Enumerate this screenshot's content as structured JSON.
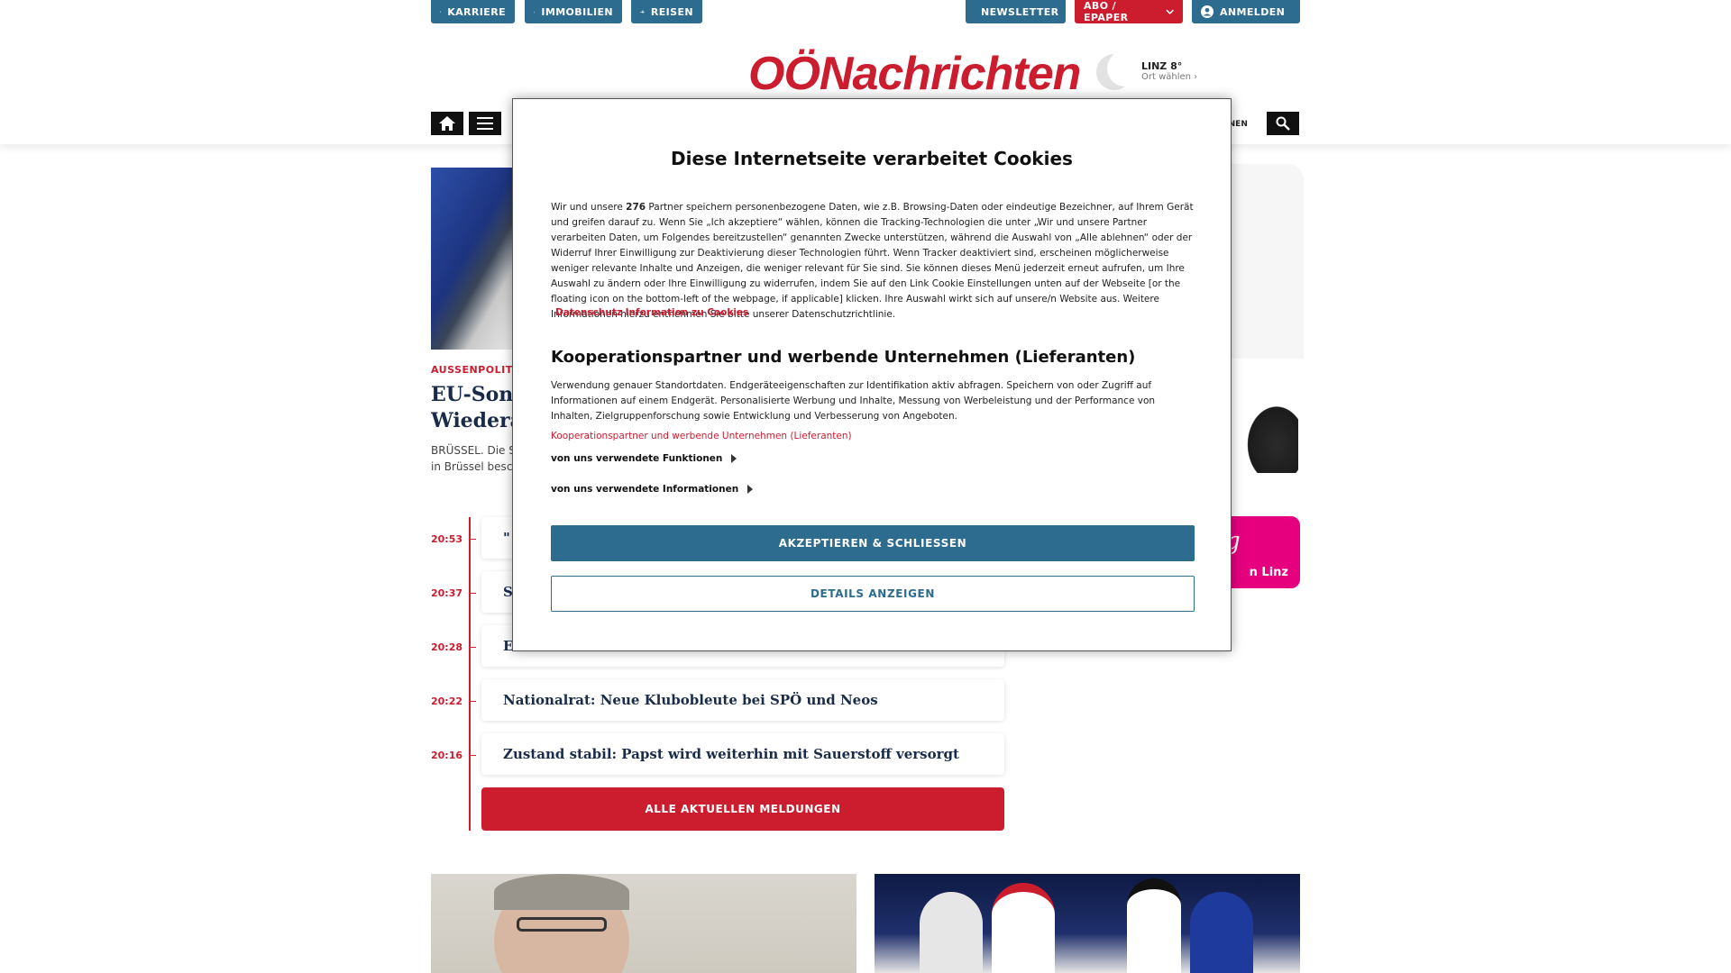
{
  "topbar": {
    "karriere": "KARRIERE",
    "immobilien": "IMMOBILIEN",
    "reisen": "REISEN",
    "newsletter": "NEWSLETTER",
    "abo": "ABO / EPAPER",
    "anmelden": "ANMELDEN"
  },
  "logo": {
    "prefix": "OÖ",
    "name": "Nachrichten"
  },
  "weather": {
    "city": "LINZ 8°",
    "select": "Ort wählen"
  },
  "nav": {
    "partial_item": "ONEN"
  },
  "colors": {
    "brand_red": "#cc1d2f",
    "brand_blue": "#2e6c8f",
    "pink_ad": "#e6007e"
  },
  "hero": {
    "kicker": "AUSSENPOLITIK",
    "headline_line1": "EU-Son",
    "headline_line2": "Wiedera",
    "teaser_line1": "BRÜSSEL. Die S",
    "teaser_line2": "in Brüssel besc"
  },
  "ad": {
    "pink_line1": "g",
    "pink_line2": "n Linz"
  },
  "timeline": {
    "items": [
      {
        "time": "20:53",
        "title": "\""
      },
      {
        "time": "20:37",
        "title": "S"
      },
      {
        "time": "20:28",
        "title": "E"
      },
      {
        "time": "20:22",
        "title": "Nationalrat: Neue Klubobleute bei SPÖ und Neos"
      },
      {
        "time": "20:16",
        "title": "Zustand stabil: Papst wird weiterhin mit Sauerstoff versorgt"
      }
    ],
    "all_button": "ALLE AKTUELLEN MELDUNGEN"
  },
  "cookie_modal": {
    "title": "Diese Internetseite verarbeitet Cookies",
    "body_before_count": "Wir und unsere ",
    "partner_count": "276",
    "body_after_count": " Partner speichern personenbezogene Daten, wie z.B. Browsing-Daten oder eindeutige Bezeichner, auf Ihrem Gerät und greifen darauf zu. Wenn Sie „Ich akzeptiere“ wählen, können die Tracking-Technologien die unter „Wir und unsere Partner verarbeiten Daten, um Folgendes bereitzustellen“ genannten Zwecke unterstützen, während die Auswahl von „Alle ablehnen“ oder der Widerruf Ihrer Einwilligung zur Deaktivierung dieser Technologien führt. Wenn Tracker deaktiviert sind, erscheinen möglicherweise weniger relevante Inhalte und Anzeigen, die weniger relevant für Sie sind. Sie können dieses Menü jederzeit erneut aufrufen, um Ihre Auswahl zu ändern oder Ihre Einwilligung zu widerrufen, indem Sie auf den Link Cookie Einstellungen unten auf der Webseite [or the floating icon on the bottom-left of the webpage, if applicable] klicken. Ihre Auswahl wirkt sich auf unsere/n Website aus. Weitere Informationen hierzu entnehmen Sie bitte unserer Datenschutzrichtlinie.",
    "privacy_link": "Datenschutz Information zu Cookies",
    "section_title": "Kooperationspartner und werbende Unternehmen (Lieferanten)",
    "section_body": "Verwendung genauer Standortdaten. Endgeräteeigenschaften zur Identifikation aktiv abfragen. Speichern von oder Zugriff auf Informationen auf einem Endgerät. Personalisierte Werbung und Inhalte, Messung von Werbeleistung und der Performance von Inhalten, Zielgruppenforschung sowie Entwicklung und Verbesserung von Angeboten.",
    "vendors_link": "Kooperationspartner und werbende Unternehmen (Lieferanten)",
    "functions_label": "von uns verwendete Funktionen",
    "info_label": "von uns verwendete Informationen",
    "accept_button": "AKZEPTIEREN & SCHLIESSEN",
    "details_button": "DETAILS ANZEIGEN"
  }
}
